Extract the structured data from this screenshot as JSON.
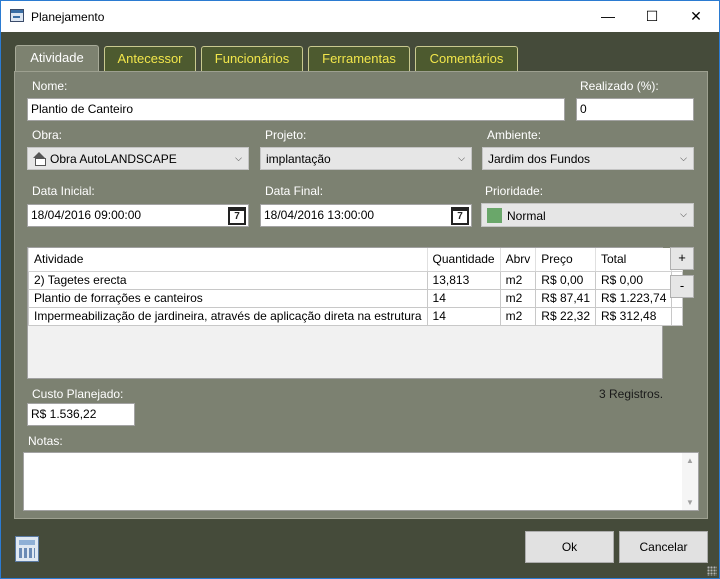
{
  "window": {
    "title": "Planejamento",
    "minimize": "—",
    "maximize": "☐",
    "close": "✕"
  },
  "tabs": [
    {
      "label": "Atividade"
    },
    {
      "label": "Antecessor"
    },
    {
      "label": "Funcionários"
    },
    {
      "label": "Ferramentas"
    },
    {
      "label": "Comentários"
    }
  ],
  "form": {
    "nome_label": "Nome:",
    "nome_value": "Plantio de Canteiro",
    "realizado_label": "Realizado (%):",
    "realizado_value": "0",
    "obra_label": "Obra:",
    "obra_value": "Obra AutoLANDSCAPE",
    "projeto_label": "Projeto:",
    "projeto_value": "implantação",
    "ambiente_label": "Ambiente:",
    "ambiente_value": "Jardim dos Fundos",
    "data_inicial_label": "Data Inicial:",
    "data_inicial_value": "18/04/2016 09:00:00",
    "data_final_label": "Data Final:",
    "data_final_value": "18/04/2016 13:00:00",
    "calendar_day": "7",
    "prioridade_label": "Prioridade:",
    "prioridade_value": "Normal",
    "prioridade_color": "#6aa76a"
  },
  "grid": {
    "columns": [
      "Atividade",
      "Quantidade",
      "Abrv",
      "Preço",
      "Total"
    ],
    "rows": [
      [
        "2) Tagetes erecta",
        "13,813",
        "m2",
        "R$ 0,00",
        "R$ 0,00"
      ],
      [
        "Plantio de forrações e canteiros",
        "14",
        "m2",
        "R$ 87,41",
        "R$ 1.223,74"
      ],
      [
        "Impermeabilização de jardineira, através de aplicação direta na estrutura",
        "14",
        "m2",
        "R$ 22,32",
        "R$ 312,48"
      ]
    ],
    "add_button": "+",
    "remove_button": "-"
  },
  "custo": {
    "label": "Custo Planejado:",
    "value": "R$ 1.536,22"
  },
  "registros": "3 Registros.",
  "notas": {
    "label": "Notas:",
    "value": ""
  },
  "buttons": {
    "ok": "Ok",
    "cancel": "Cancelar"
  },
  "colors": {
    "panel": "#7c8171",
    "frame": "#454b3a",
    "tab_text": "#f2e64b",
    "tab_bg": "#4d5a2f"
  }
}
